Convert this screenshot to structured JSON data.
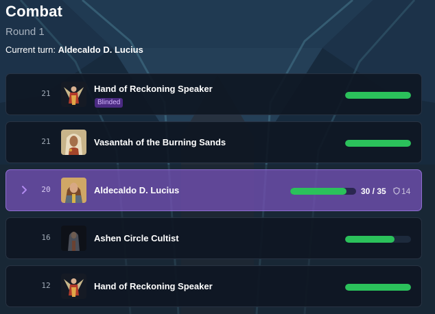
{
  "header": {
    "title": "Combat",
    "round": "Round 1",
    "turn_label": "Current turn:",
    "turn_name": "Aldecaldo D. Lucius"
  },
  "combatants": [
    {
      "initiative": "21",
      "name": "Hand of Reckoning Speaker",
      "condition": "Blinded",
      "hp_fraction": 1.0,
      "active": false,
      "portrait_icon": "winged-warrior-icon"
    },
    {
      "initiative": "21",
      "name": "Vasantah of the Burning Sands",
      "condition": "",
      "hp_fraction": 1.0,
      "active": false,
      "portrait_icon": "hooded-figure-icon"
    },
    {
      "initiative": "20",
      "name": "Aldecaldo D. Lucius",
      "condition": "",
      "hp_fraction": 0.857,
      "hp_text": "30 / 35",
      "ac": "14",
      "active": true,
      "portrait_icon": "armored-hero-icon"
    },
    {
      "initiative": "16",
      "name": "Ashen Circle Cultist",
      "condition": "",
      "hp_fraction": 0.75,
      "active": false,
      "portrait_icon": "cultist-icon"
    },
    {
      "initiative": "12",
      "name": "Hand of Reckoning Speaker",
      "condition": "",
      "hp_fraction": 1.0,
      "active": false,
      "portrait_icon": "winged-warrior-icon"
    }
  ],
  "colors": {
    "hp_fill": "#2bc15b",
    "active_row": "#7a54be",
    "condition_badge": "#4b2a82",
    "condition_text": "#d6b8ff"
  }
}
